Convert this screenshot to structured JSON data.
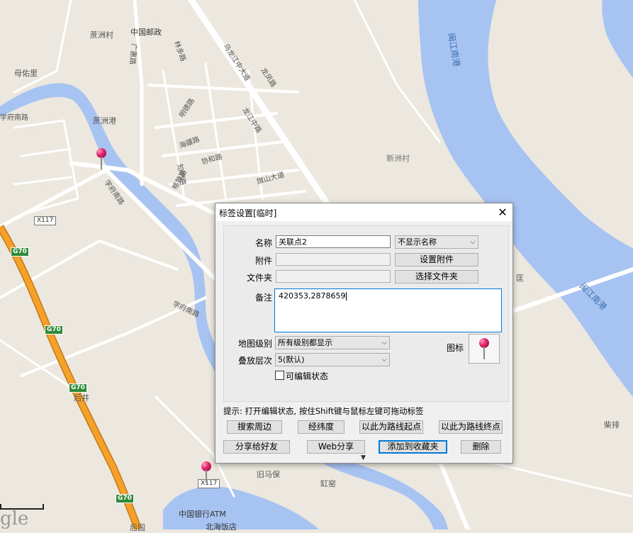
{
  "map": {
    "labels": {
      "puzhou_village": "蔗洲村",
      "china_post": "中国邮政",
      "guanghui_road": "广惠路",
      "linduo_road": "林多路",
      "wulong_avenue": "乌龙江中大道",
      "longfeng_road": "龙凤路",
      "muyou_li": "母佑里",
      "xuefu_south_road_left": "学府南路",
      "mingde_road": "明德路",
      "puzhou_port": "蔗洲港",
      "longjiang_middle_road": "龙江中路",
      "haihui_road": "海疆路",
      "xiehe_road": "协和路",
      "xinzhou_village": "新洲村",
      "gezhi_road": "格致路",
      "zhiming_road": "知明路",
      "qishan_avenue": "旗山大道",
      "xuefu_south_road_diag": "学府南路",
      "minjiang_south_port_top": "闽江南港",
      "minjiang_south_port_right": "闽江南港",
      "xuefu_south_road_bottom": "学府南路",
      "houjing": "后井",
      "jiumabao": "旧马保",
      "gangyao": "缸窑",
      "boc_atm": "中国银行ATM",
      "beihai_hotel": "北海饭店",
      "houyuan": "后园",
      "kuang": "匡",
      "chaipai": "柴排",
      "google_mark": "gle"
    },
    "shields": {
      "g70_a": "G70",
      "g70_b": "G70",
      "g70_c": "G70",
      "g70_d": "G70",
      "x117_a": "X117",
      "x117_b": "X117"
    },
    "colors": {
      "land": "#ece8df",
      "water": "#a7c3f2",
      "road": "#ffffff",
      "expressway": "#f5a02a"
    }
  },
  "dialog": {
    "title": "标签设置[临时]",
    "close_glyph": "✕",
    "fields": {
      "name_label": "名称",
      "name_value": "关联点2",
      "name_display_option": "不显示名称",
      "attachment_label": "附件",
      "attachment_value": "",
      "set_attachment_button": "设置附件",
      "folder_label": "文件夹",
      "folder_value": "",
      "choose_folder_button": "选择文件夹",
      "memo_label": "备注",
      "memo_value": "420353,2878659",
      "map_level_label": "地图级别",
      "map_level_value": "所有级别都显示",
      "layer_label": "叠放层次",
      "layer_value": "5(默认)",
      "icon_label": "图标",
      "editable_label": "可编辑状态",
      "editable_checked": false
    },
    "hint": "提示: 打开编辑状态, 按住Shift键与鼠标左键可拖动标签",
    "buttons": {
      "search_nearby": "搜索周边",
      "lat_lon": "经纬度",
      "route_start": "以此为路线起点",
      "route_end": "以此为路线终点",
      "share_friend": "分享给好友",
      "web_share": "Web分享",
      "add_favorite": "添加到收藏夹",
      "delete": "删除"
    },
    "more_glyph": "▼",
    "combo_arrow": "⌵"
  }
}
